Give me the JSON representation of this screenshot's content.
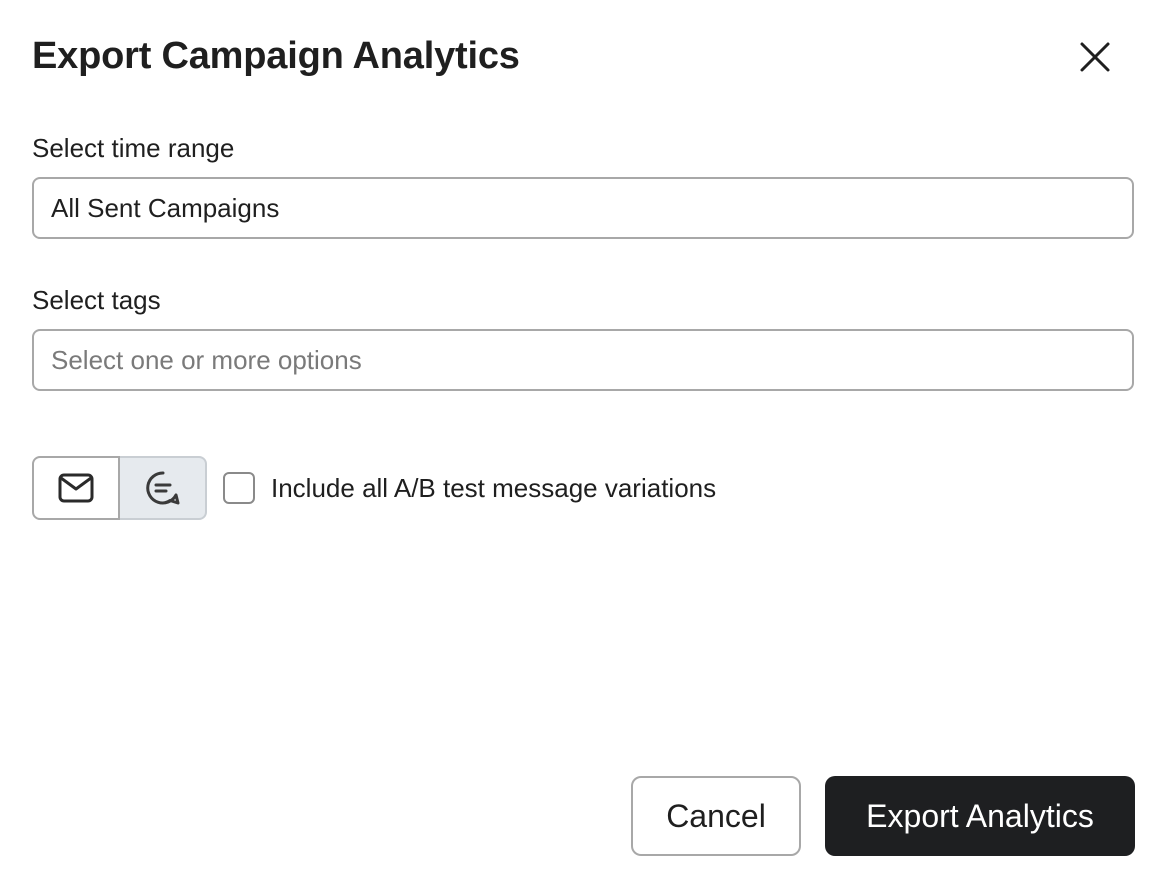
{
  "dialog": {
    "title": "Export Campaign Analytics"
  },
  "time_range": {
    "label": "Select time range",
    "value": "All Sent Campaigns"
  },
  "tags": {
    "label": "Select tags",
    "placeholder": "Select one or more options",
    "value": ""
  },
  "channel_toggle": {
    "options": [
      {
        "icon": "envelope-icon",
        "selected": true
      },
      {
        "icon": "chat-bubble-icon",
        "selected": false
      }
    ]
  },
  "ab_variations": {
    "label": "Include all A/B test message variations",
    "checked": false
  },
  "actions": {
    "cancel_label": "Cancel",
    "export_label": "Export Analytics"
  },
  "colors": {
    "primary_button": "#1e1f21",
    "border": "#a8a8a8",
    "toggle_inactive_bg": "#e6eaee"
  }
}
